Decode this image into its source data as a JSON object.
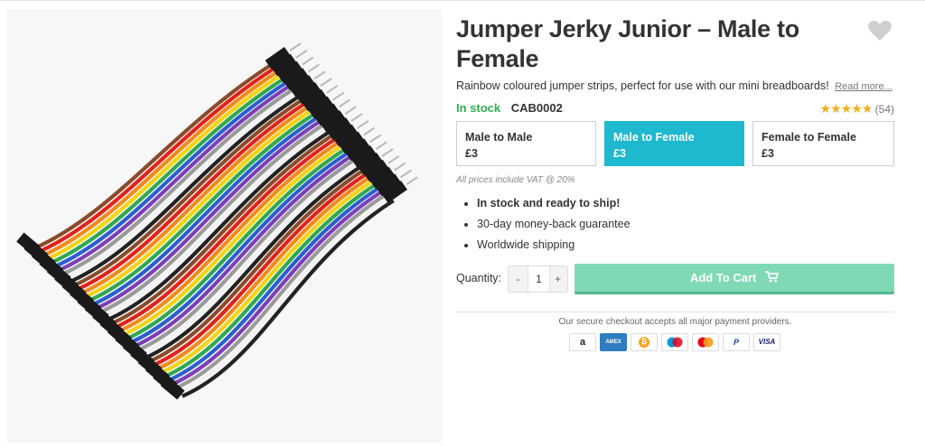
{
  "product": {
    "title": "Jumper Jerky Junior – Male to Female",
    "description": "Rainbow coloured jumper strips, perfect for use with our mini breadboards!",
    "read_more": "Read more...",
    "stock_status": "In stock",
    "sku": "CAB0002",
    "rating": {
      "stars": "★★★★★",
      "count": "(54)"
    }
  },
  "variants": [
    {
      "name": "Male to Male",
      "price": "£3"
    },
    {
      "name": "Male to Female",
      "price": "£3",
      "selected": true
    },
    {
      "name": "Female to Female",
      "price": "£3"
    }
  ],
  "vat_note": "All prices include VAT @ 20%",
  "bullets": [
    "In stock and ready to ship!",
    "30-day money-back guarantee",
    "Worldwide shipping"
  ],
  "quantity": {
    "label": "Quantity:",
    "value": "1",
    "minus": "-",
    "plus": "+"
  },
  "cart": {
    "label": "Add To Cart",
    "icon": "cart-icon"
  },
  "checkout": {
    "note": "Our secure checkout accepts all major payment providers.",
    "methods": [
      "amazon",
      "amex",
      "bitcoin",
      "maestro",
      "mastercard",
      "paypal",
      "visa"
    ],
    "labels": {
      "amazon": "a",
      "amex": "AMEX",
      "bitcoin": "₿",
      "paypal": "P",
      "visa": "VISA"
    }
  },
  "colors": {
    "accent": "#1eb8cf",
    "cart": "#7fd9b5",
    "stock": "#2fae4f",
    "stars": "#f2b01e"
  }
}
